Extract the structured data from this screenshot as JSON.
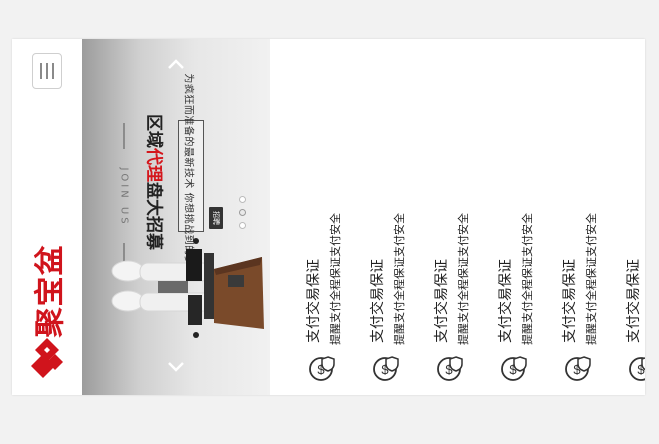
{
  "header": {
    "logo_text": "聚宝盆",
    "brand_color": "#d0141c",
    "menu_icon": "menu-icon"
  },
  "banner": {
    "join_us": "JOIN US",
    "headline_pre": "区域",
    "headline_mid": "代理",
    "headline_post": "盘大招募",
    "subtitle": "为疯狂而准备的最新技术 你想挑战到的梦想",
    "tag": "招聘",
    "arrow_up_icon": "chevron-up-icon",
    "arrow_down_icon": "chevron-down-icon",
    "slides": 3,
    "active_slide": 2
  },
  "services": {
    "icon": "dollar-shield-icon",
    "items": [
      {
        "title": "支付交易保证",
        "desc": "提醒支付全程保证支付安全"
      },
      {
        "title": "支付交易保证",
        "desc": "提醒支付全程保证支付安全"
      },
      {
        "title": "支付交易保证",
        "desc": "提醒支付全程保证支付安全"
      },
      {
        "title": "支付交易保证",
        "desc": "提醒支付全程保证支付安全"
      },
      {
        "title": "支付交易保证",
        "desc": "提醒支付全程保证支付安全"
      },
      {
        "title": "支付交易保证",
        "desc": ""
      }
    ]
  }
}
